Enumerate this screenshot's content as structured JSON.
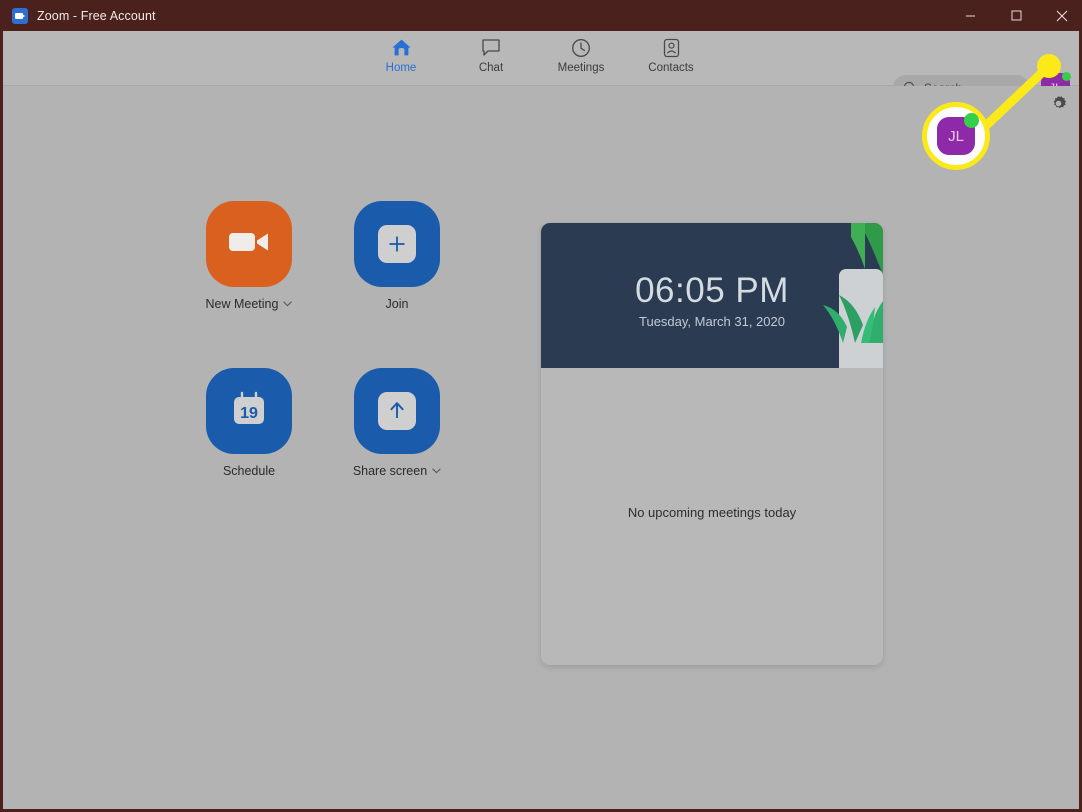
{
  "window": {
    "title": "Zoom - Free Account",
    "app_icon": "zoom-video-icon",
    "minimize_label": "Minimize",
    "maximize_label": "Maximize",
    "close_label": "Close",
    "titlebar_color": "#4a211c",
    "body_color": "#b3b3b3"
  },
  "nav": {
    "items": [
      {
        "label": "Home",
        "icon": "home-icon",
        "active": true
      },
      {
        "label": "Chat",
        "icon": "chat-bubble-icon",
        "active": false
      },
      {
        "label": "Meetings",
        "icon": "clock-icon",
        "active": false
      },
      {
        "label": "Contacts",
        "icon": "contact-card-icon",
        "active": false
      }
    ],
    "active_color": "#2a6fd4"
  },
  "search": {
    "placeholder": "Search",
    "icon": "search-icon"
  },
  "profile": {
    "initials": "JL",
    "avatar_color": "#8e29a8",
    "status": "available",
    "status_color": "#35d04a"
  },
  "settings": {
    "icon": "gear-icon",
    "label": "Settings"
  },
  "actions": [
    {
      "label": "New Meeting",
      "icon": "video-camera-icon",
      "tile_color": "#d9601f",
      "has_dropdown": true
    },
    {
      "label": "Join",
      "icon": "plus-square-icon",
      "tile_color": "#1a5bab",
      "has_dropdown": false
    },
    {
      "label": "Schedule",
      "icon": "calendar-icon",
      "tile_color": "#1a5bab",
      "has_dropdown": false,
      "calendar_day": "19"
    },
    {
      "label": "Share screen",
      "icon": "up-arrow-square-icon",
      "tile_color": "#1a5bab",
      "has_dropdown": true
    }
  ],
  "meetings_panel": {
    "time": "06:05 PM",
    "date": "Tuesday, March 31, 2020",
    "empty_message": "No upcoming meetings today",
    "card_color": "#2b3c52",
    "illustration": "potted-plant-illustration"
  },
  "callout": {
    "target": "profile-avatar",
    "highlight_color": "#fbe919",
    "initials": "JL"
  }
}
